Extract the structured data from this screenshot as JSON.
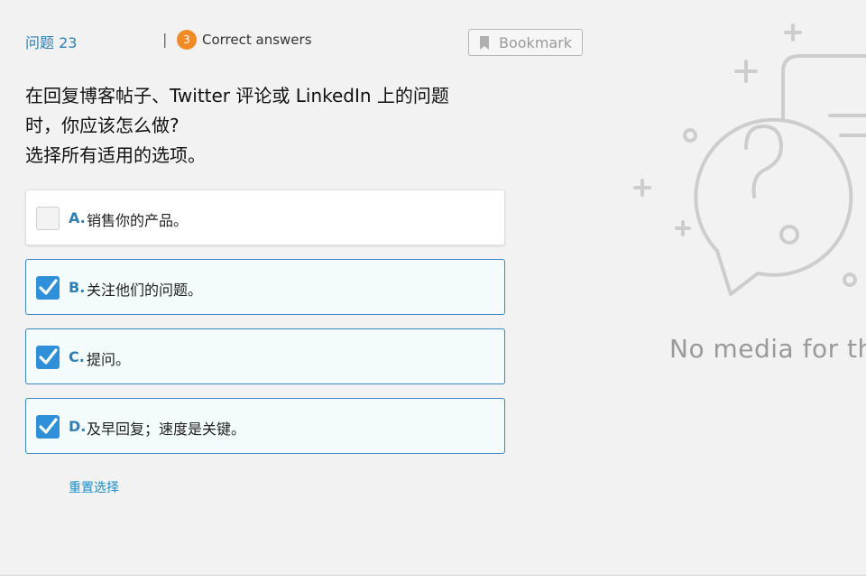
{
  "header": {
    "question_number": "问题 23",
    "separator": "|",
    "correct_count": "3",
    "correct_label": "Correct answers",
    "bookmark_label": "Bookmark",
    "bookmark_icon": "bookmark-icon"
  },
  "question": {
    "lines": [
      "在回复博客帖子、Twitter 评论或 LinkedIn 上的问题",
      "时，你应该怎么做?",
      "选择所有适用的选项。"
    ]
  },
  "options": [
    {
      "letter": "A.",
      "text": "销售你的产品。",
      "checked": false
    },
    {
      "letter": "B.",
      "text": "关注他们的问题。",
      "checked": true
    },
    {
      "letter": "C.",
      "text": "提问。",
      "checked": true
    },
    {
      "letter": "D.",
      "text": "及早回复；速度是关键。",
      "checked": true
    }
  ],
  "reset_label": "重置选择",
  "media": {
    "illustration_icon": "question-speech-bubble-icon",
    "no_media_text": "No media for this"
  },
  "colors": {
    "background": "#f2f2f2",
    "accent_blue": "#2f7fb7",
    "checkbox_blue": "#2f8fd8",
    "badge_orange": "#f08a24",
    "link_blue": "#1a8ec9"
  }
}
